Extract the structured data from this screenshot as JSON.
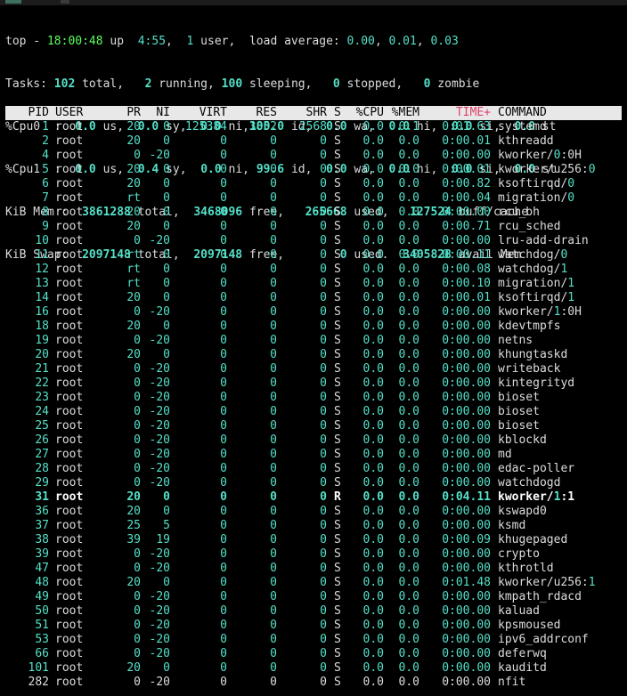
{
  "summary": {
    "line1": {
      "a": "top - ",
      "time": "18:00:48",
      "b": " up  ",
      "uptime": "4:55",
      "c": ",  ",
      "users": "1",
      "d": " user,  load average: ",
      "load1": "0.00",
      "e": ", ",
      "load5": "0.01",
      "f": ", ",
      "load15": "0.03"
    },
    "line2": {
      "a": "Tasks: ",
      "total": "102",
      "b": " total,   ",
      "running": "2",
      "c": " running, ",
      "sleeping": "100",
      "d": " sleeping,   ",
      "stopped": "0",
      "e": " stopped,   ",
      "zombie": "0",
      "f": " zombie"
    },
    "line3": {
      "a": "%Cpu0  :  ",
      "us": "0.0",
      "b": " us,  ",
      "sy": "0.0",
      "c": " sy,  ",
      "ni": "0.0",
      "d": " ni,",
      "id": "100.0",
      "e": " id,  ",
      "wa": "0.0",
      "f": " wa,  ",
      "hi": "0.0",
      "g": " hi,  ",
      "si": "0.0",
      "h": " si,  ",
      "st": "0.0",
      "i": " st"
    },
    "line4": {
      "a": "%Cpu1  :  ",
      "us": "0.0",
      "b": " us,  ",
      "sy": "0.4",
      "c": " sy,  ",
      "ni": "0.0",
      "d": " ni, ",
      "id": "99.6",
      "e": " id,  ",
      "wa": "0.0",
      "f": " wa,  ",
      "hi": "0.0",
      "g": " hi,  ",
      "si": "0.0",
      "h": " si,  ",
      "st": "0.0",
      "i": " st"
    },
    "line5": {
      "a": "KiB Mem :  ",
      "total": "3861288",
      "b": " total,  ",
      "free": "3468096",
      "c": " free,   ",
      "used": "265668",
      "d": " used,   ",
      "buff": "127524",
      "e": " buff/cache"
    },
    "line6": {
      "a": "KiB Swap:  ",
      "total": "2097148",
      "b": " total,  ",
      "free": "2097148",
      "c": " free,        ",
      "used": "0",
      "d": " used.  ",
      "avail": "3405828",
      "e": " avail Mem"
    }
  },
  "columns": [
    "PID",
    "USER",
    "PR",
    "NI",
    "VIRT",
    "RES",
    "SHR",
    "S",
    "%CPU",
    "%MEM",
    "TIME+",
    "COMMAND"
  ],
  "processes": [
    {
      "pid": "1",
      "user": "root",
      "pr": "20",
      "ni": "0",
      "virt": "125384",
      "res": "3852",
      "shr": "2568",
      "s": "S",
      "cpu": "0.0",
      "mem": "0.1",
      "time": "0:01.63",
      "cmd": "systemd",
      "cmd2": ""
    },
    {
      "pid": "2",
      "user": "root",
      "pr": "20",
      "ni": "0",
      "virt": "0",
      "res": "0",
      "shr": "0",
      "s": "S",
      "cpu": "0.0",
      "mem": "0.0",
      "time": "0:00.01",
      "cmd": "kthreadd",
      "cmd2": ""
    },
    {
      "pid": "4",
      "user": "root",
      "pr": "0",
      "ni": "-20",
      "virt": "0",
      "res": "0",
      "shr": "0",
      "s": "S",
      "cpu": "0.0",
      "mem": "0.0",
      "time": "0:00.00",
      "cmd": "kworker/",
      "cmd2": "0",
      "cmd3": ":0H"
    },
    {
      "pid": "5",
      "user": "root",
      "pr": "20",
      "ni": "0",
      "virt": "0",
      "res": "0",
      "shr": "0",
      "s": "S",
      "cpu": "0.0",
      "mem": "0.0",
      "time": "0:00.01",
      "cmd": "kworker/u256:",
      "cmd2": "0"
    },
    {
      "pid": "6",
      "user": "root",
      "pr": "20",
      "ni": "0",
      "virt": "0",
      "res": "0",
      "shr": "0",
      "s": "S",
      "cpu": "0.0",
      "mem": "0.0",
      "time": "0:00.82",
      "cmd": "ksoftirqd/",
      "cmd2": "0"
    },
    {
      "pid": "7",
      "user": "root",
      "pr": "rt",
      "ni": "0",
      "virt": "0",
      "res": "0",
      "shr": "0",
      "s": "S",
      "cpu": "0.0",
      "mem": "0.0",
      "time": "0:00.04",
      "cmd": "migration/",
      "cmd2": "0"
    },
    {
      "pid": "8",
      "user": "root",
      "pr": "20",
      "ni": "0",
      "virt": "0",
      "res": "0",
      "shr": "0",
      "s": "S",
      "cpu": "0.0",
      "mem": "0.0",
      "time": "0:00.00",
      "cmd": "rcu_bh",
      "cmd2": ""
    },
    {
      "pid": "9",
      "user": "root",
      "pr": "20",
      "ni": "0",
      "virt": "0",
      "res": "0",
      "shr": "0",
      "s": "S",
      "cpu": "0.0",
      "mem": "0.0",
      "time": "0:00.71",
      "cmd": "rcu_sched",
      "cmd2": ""
    },
    {
      "pid": "10",
      "user": "root",
      "pr": "0",
      "ni": "-20",
      "virt": "0",
      "res": "0",
      "shr": "0",
      "s": "S",
      "cpu": "0.0",
      "mem": "0.0",
      "time": "0:00.00",
      "cmd": "lru-add-drain",
      "cmd2": ""
    },
    {
      "pid": "11",
      "user": "root",
      "pr": "rt",
      "ni": "0",
      "virt": "0",
      "res": "0",
      "shr": "0",
      "s": "S",
      "cpu": "0.0",
      "mem": "0.0",
      "time": "0:00.11",
      "cmd": "watchdog/",
      "cmd2": "0"
    },
    {
      "pid": "12",
      "user": "root",
      "pr": "rt",
      "ni": "0",
      "virt": "0",
      "res": "0",
      "shr": "0",
      "s": "S",
      "cpu": "0.0",
      "mem": "0.0",
      "time": "0:00.08",
      "cmd": "watchdog/",
      "cmd2": "1"
    },
    {
      "pid": "13",
      "user": "root",
      "pr": "rt",
      "ni": "0",
      "virt": "0",
      "res": "0",
      "shr": "0",
      "s": "S",
      "cpu": "0.0",
      "mem": "0.0",
      "time": "0:00.10",
      "cmd": "migration/",
      "cmd2": "1"
    },
    {
      "pid": "14",
      "user": "root",
      "pr": "20",
      "ni": "0",
      "virt": "0",
      "res": "0",
      "shr": "0",
      "s": "S",
      "cpu": "0.0",
      "mem": "0.0",
      "time": "0:00.01",
      "cmd": "ksoftirqd/",
      "cmd2": "1"
    },
    {
      "pid": "16",
      "user": "root",
      "pr": "0",
      "ni": "-20",
      "virt": "0",
      "res": "0",
      "shr": "0",
      "s": "S",
      "cpu": "0.0",
      "mem": "0.0",
      "time": "0:00.00",
      "cmd": "kworker/",
      "cmd2": "1",
      "cmd3": ":0H"
    },
    {
      "pid": "18",
      "user": "root",
      "pr": "20",
      "ni": "0",
      "virt": "0",
      "res": "0",
      "shr": "0",
      "s": "S",
      "cpu": "0.0",
      "mem": "0.0",
      "time": "0:00.00",
      "cmd": "kdevtmpfs",
      "cmd2": ""
    },
    {
      "pid": "19",
      "user": "root",
      "pr": "0",
      "ni": "-20",
      "virt": "0",
      "res": "0",
      "shr": "0",
      "s": "S",
      "cpu": "0.0",
      "mem": "0.0",
      "time": "0:00.00",
      "cmd": "netns",
      "cmd2": ""
    },
    {
      "pid": "20",
      "user": "root",
      "pr": "20",
      "ni": "0",
      "virt": "0",
      "res": "0",
      "shr": "0",
      "s": "S",
      "cpu": "0.0",
      "mem": "0.0",
      "time": "0:00.00",
      "cmd": "khungtaskd",
      "cmd2": ""
    },
    {
      "pid": "21",
      "user": "root",
      "pr": "0",
      "ni": "-20",
      "virt": "0",
      "res": "0",
      "shr": "0",
      "s": "S",
      "cpu": "0.0",
      "mem": "0.0",
      "time": "0:00.00",
      "cmd": "writeback",
      "cmd2": ""
    },
    {
      "pid": "22",
      "user": "root",
      "pr": "0",
      "ni": "-20",
      "virt": "0",
      "res": "0",
      "shr": "0",
      "s": "S",
      "cpu": "0.0",
      "mem": "0.0",
      "time": "0:00.00",
      "cmd": "kintegrityd",
      "cmd2": ""
    },
    {
      "pid": "23",
      "user": "root",
      "pr": "0",
      "ni": "-20",
      "virt": "0",
      "res": "0",
      "shr": "0",
      "s": "S",
      "cpu": "0.0",
      "mem": "0.0",
      "time": "0:00.00",
      "cmd": "bioset",
      "cmd2": ""
    },
    {
      "pid": "24",
      "user": "root",
      "pr": "0",
      "ni": "-20",
      "virt": "0",
      "res": "0",
      "shr": "0",
      "s": "S",
      "cpu": "0.0",
      "mem": "0.0",
      "time": "0:00.00",
      "cmd": "bioset",
      "cmd2": ""
    },
    {
      "pid": "25",
      "user": "root",
      "pr": "0",
      "ni": "-20",
      "virt": "0",
      "res": "0",
      "shr": "0",
      "s": "S",
      "cpu": "0.0",
      "mem": "0.0",
      "time": "0:00.00",
      "cmd": "bioset",
      "cmd2": ""
    },
    {
      "pid": "26",
      "user": "root",
      "pr": "0",
      "ni": "-20",
      "virt": "0",
      "res": "0",
      "shr": "0",
      "s": "S",
      "cpu": "0.0",
      "mem": "0.0",
      "time": "0:00.00",
      "cmd": "kblockd",
      "cmd2": ""
    },
    {
      "pid": "27",
      "user": "root",
      "pr": "0",
      "ni": "-20",
      "virt": "0",
      "res": "0",
      "shr": "0",
      "s": "S",
      "cpu": "0.0",
      "mem": "0.0",
      "time": "0:00.00",
      "cmd": "md",
      "cmd2": ""
    },
    {
      "pid": "28",
      "user": "root",
      "pr": "0",
      "ni": "-20",
      "virt": "0",
      "res": "0",
      "shr": "0",
      "s": "S",
      "cpu": "0.0",
      "mem": "0.0",
      "time": "0:00.00",
      "cmd": "edac-poller",
      "cmd2": ""
    },
    {
      "pid": "29",
      "user": "root",
      "pr": "0",
      "ni": "-20",
      "virt": "0",
      "res": "0",
      "shr": "0",
      "s": "S",
      "cpu": "0.0",
      "mem": "0.0",
      "time": "0:00.00",
      "cmd": "watchdogd",
      "cmd2": ""
    },
    {
      "pid": "31",
      "user": "root",
      "pr": "20",
      "ni": "0",
      "virt": "0",
      "res": "0",
      "shr": "0",
      "s": "R",
      "cpu": "0.0",
      "mem": "0.0",
      "time": "0:04.11",
      "cmd": "kworker/",
      "cmd2": "1",
      "cmd3": ":1",
      "highlight": true
    },
    {
      "pid": "36",
      "user": "root",
      "pr": "20",
      "ni": "0",
      "virt": "0",
      "res": "0",
      "shr": "0",
      "s": "S",
      "cpu": "0.0",
      "mem": "0.0",
      "time": "0:00.00",
      "cmd": "kswapd0",
      "cmd2": ""
    },
    {
      "pid": "37",
      "user": "root",
      "pr": "25",
      "ni": "5",
      "virt": "0",
      "res": "0",
      "shr": "0",
      "s": "S",
      "cpu": "0.0",
      "mem": "0.0",
      "time": "0:00.00",
      "cmd": "ksmd",
      "cmd2": ""
    },
    {
      "pid": "38",
      "user": "root",
      "pr": "39",
      "ni": "19",
      "virt": "0",
      "res": "0",
      "shr": "0",
      "s": "S",
      "cpu": "0.0",
      "mem": "0.0",
      "time": "0:00.09",
      "cmd": "khugepaged",
      "cmd2": ""
    },
    {
      "pid": "39",
      "user": "root",
      "pr": "0",
      "ni": "-20",
      "virt": "0",
      "res": "0",
      "shr": "0",
      "s": "S",
      "cpu": "0.0",
      "mem": "0.0",
      "time": "0:00.00",
      "cmd": "crypto",
      "cmd2": ""
    },
    {
      "pid": "47",
      "user": "root",
      "pr": "0",
      "ni": "-20",
      "virt": "0",
      "res": "0",
      "shr": "0",
      "s": "S",
      "cpu": "0.0",
      "mem": "0.0",
      "time": "0:00.00",
      "cmd": "kthrotld",
      "cmd2": ""
    },
    {
      "pid": "48",
      "user": "root",
      "pr": "20",
      "ni": "0",
      "virt": "0",
      "res": "0",
      "shr": "0",
      "s": "S",
      "cpu": "0.0",
      "mem": "0.0",
      "time": "0:01.48",
      "cmd": "kworker/u256:",
      "cmd2": "1"
    },
    {
      "pid": "49",
      "user": "root",
      "pr": "0",
      "ni": "-20",
      "virt": "0",
      "res": "0",
      "shr": "0",
      "s": "S",
      "cpu": "0.0",
      "mem": "0.0",
      "time": "0:00.00",
      "cmd": "kmpath_rdacd",
      "cmd2": ""
    },
    {
      "pid": "50",
      "user": "root",
      "pr": "0",
      "ni": "-20",
      "virt": "0",
      "res": "0",
      "shr": "0",
      "s": "S",
      "cpu": "0.0",
      "mem": "0.0",
      "time": "0:00.00",
      "cmd": "kaluad",
      "cmd2": ""
    },
    {
      "pid": "51",
      "user": "root",
      "pr": "0",
      "ni": "-20",
      "virt": "0",
      "res": "0",
      "shr": "0",
      "s": "S",
      "cpu": "0.0",
      "mem": "0.0",
      "time": "0:00.00",
      "cmd": "kpsmoused",
      "cmd2": ""
    },
    {
      "pid": "53",
      "user": "root",
      "pr": "0",
      "ni": "-20",
      "virt": "0",
      "res": "0",
      "shr": "0",
      "s": "S",
      "cpu": "0.0",
      "mem": "0.0",
      "time": "0:00.00",
      "cmd": "ipv6_addrconf",
      "cmd2": ""
    },
    {
      "pid": "66",
      "user": "root",
      "pr": "0",
      "ni": "-20",
      "virt": "0",
      "res": "0",
      "shr": "0",
      "s": "S",
      "cpu": "0.0",
      "mem": "0.0",
      "time": "0:00.00",
      "cmd": "deferwq",
      "cmd2": ""
    },
    {
      "pid": "101",
      "user": "root",
      "pr": "20",
      "ni": "0",
      "virt": "0",
      "res": "0",
      "shr": "0",
      "s": "S",
      "cpu": "0.0",
      "mem": "0.0",
      "time": "0:00.00",
      "cmd": "kauditd",
      "cmd2": ""
    },
    {
      "pid": "282",
      "user": "root",
      "pr": "0",
      "ni": "-20",
      "virt": "0",
      "res": "0",
      "shr": "0",
      "s": "S",
      "cpu": "0.0",
      "mem": "0.0",
      "time": "0:00.00",
      "cmd": "nfit",
      "cmd2": "",
      "plain": true
    }
  ]
}
